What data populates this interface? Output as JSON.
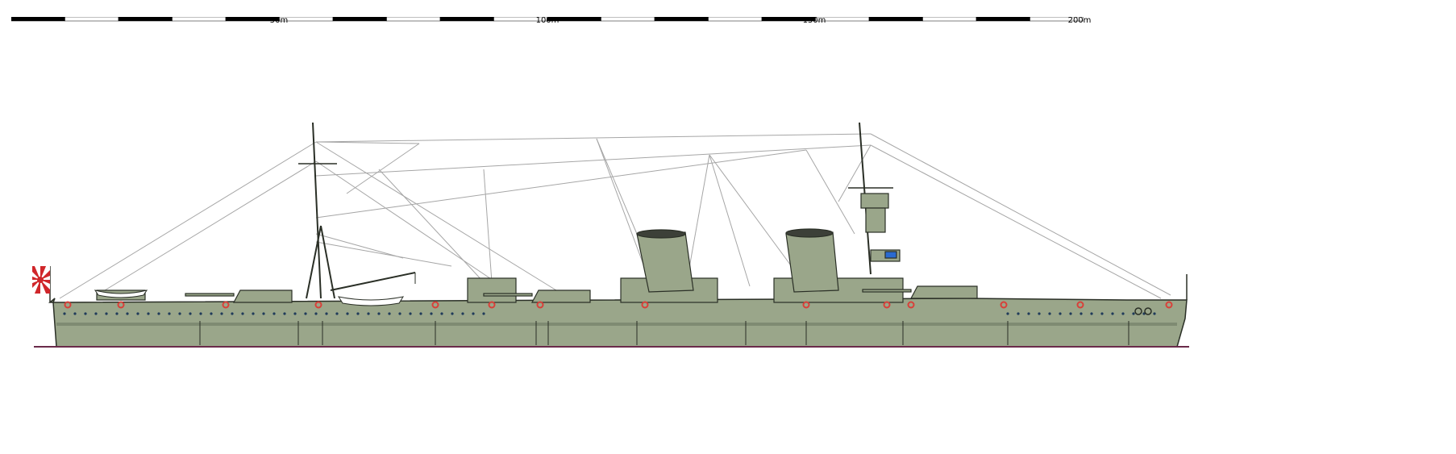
{
  "scale": {
    "unit": "m",
    "labels": [
      "50m",
      "100m",
      "150m",
      "200m"
    ],
    "segment_colors": [
      "#000000",
      "#ffffff"
    ]
  },
  "colors": {
    "hull": "#9aa68a",
    "hull_dark": "#7f8b72",
    "outline": "#2a2f26",
    "funnel_cap": "#3c4038",
    "rigging": "#a6a6a6",
    "waterline": "#6a2a4a",
    "porthole": "#1f3a5a",
    "lifebuoy": "#d8403a",
    "flag_red": "#d0262a",
    "flag_white": "#ffffff",
    "window_blue": "#2a6ad0"
  },
  "icons": {
    "flag": "rising-sun-flag-icon",
    "anchor": "anchor-icon",
    "boat": "lifeboat-icon",
    "gun": "gun-turret-icon"
  }
}
